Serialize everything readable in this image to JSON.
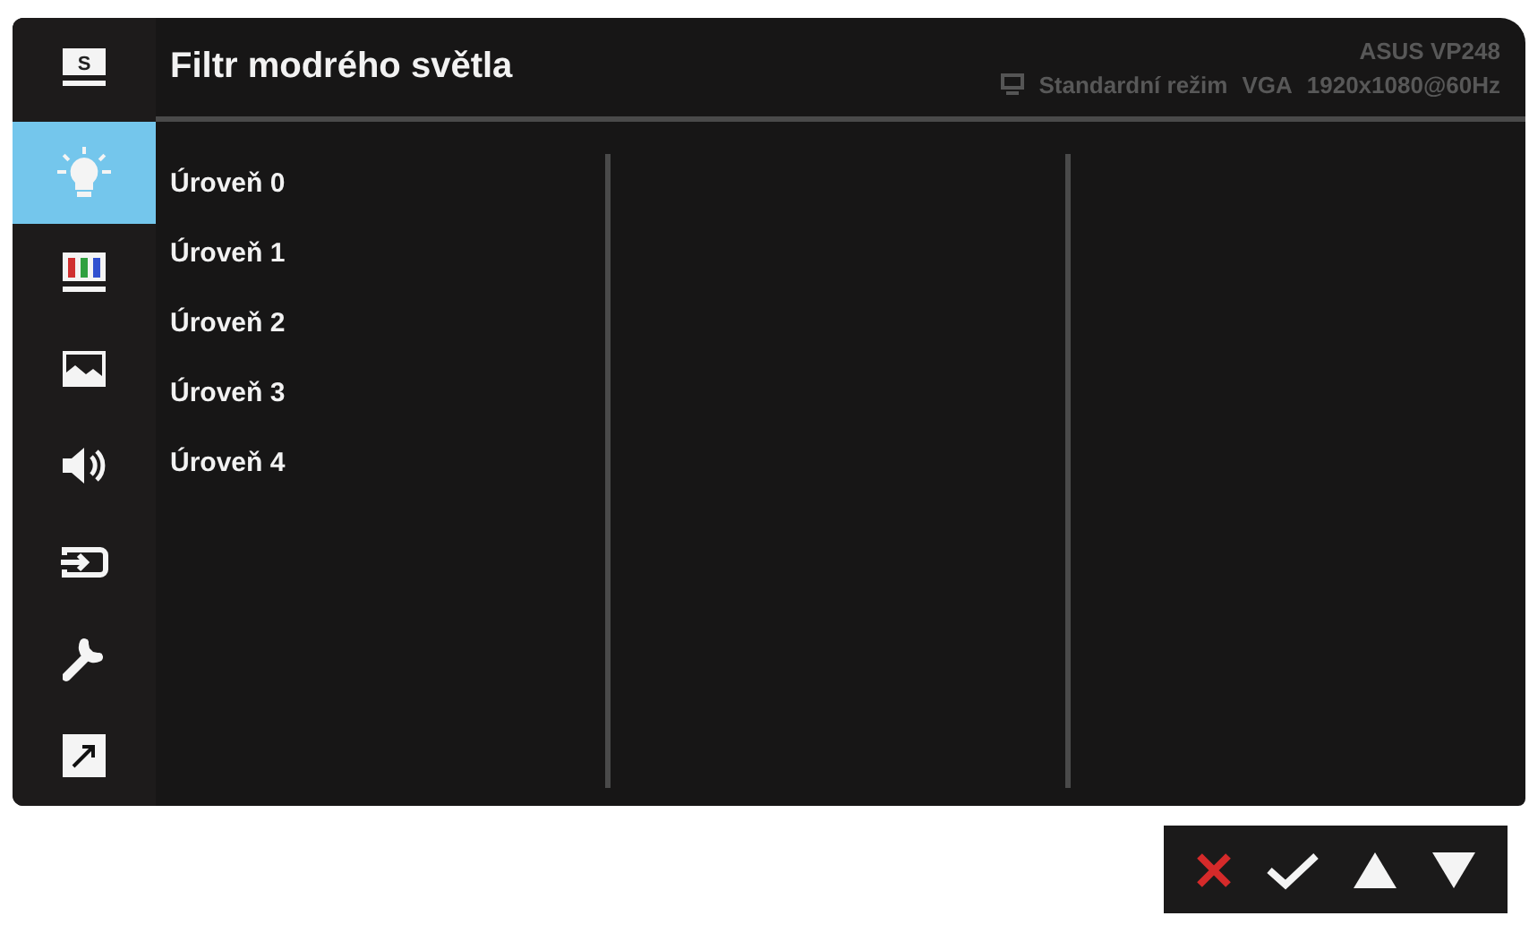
{
  "header": {
    "badge": "S",
    "title": "Filtr modrého světla",
    "model": "ASUS  VP248",
    "status": [
      "Standardní režim",
      "VGA",
      "1920x1080@60Hz"
    ]
  },
  "sidebar": [
    {
      "kind": "bulb",
      "selected": true
    },
    {
      "kind": "colors",
      "selected": false
    },
    {
      "kind": "image",
      "selected": false
    },
    {
      "kind": "sound",
      "selected": false
    },
    {
      "kind": "input",
      "selected": false
    },
    {
      "kind": "wrench",
      "selected": false
    },
    {
      "kind": "shortcut",
      "selected": false
    }
  ],
  "options": [
    "Úroveň 0",
    "Úroveň 1",
    "Úroveň 2",
    "Úroveň 3",
    "Úroveň 4"
  ],
  "keys": [
    {
      "kind": "close"
    },
    {
      "kind": "confirm"
    },
    {
      "kind": "up"
    },
    {
      "kind": "down"
    }
  ]
}
